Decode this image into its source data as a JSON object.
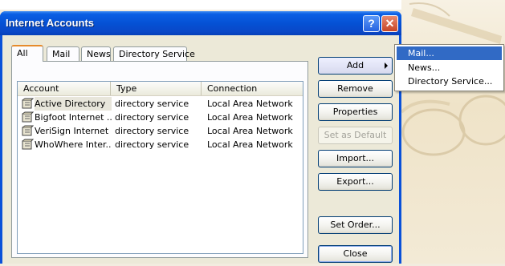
{
  "window": {
    "title": "Internet Accounts",
    "help_button": "?",
    "close_button": "✕"
  },
  "tabs": [
    {
      "label": "All",
      "active": true
    },
    {
      "label": "Mail",
      "active": false
    },
    {
      "label": "News",
      "active": false
    },
    {
      "label": "Directory Service",
      "active": false
    }
  ],
  "table": {
    "columns": [
      "Account",
      "Type",
      "Connection"
    ],
    "rows": [
      {
        "account": "Active Directory",
        "type": "directory service",
        "connection": "Local Area Network"
      },
      {
        "account": "Bigfoot Internet ...",
        "type": "directory service",
        "connection": "Local Area Network"
      },
      {
        "account": "VeriSign Internet ...",
        "type": "directory service",
        "connection": "Local Area Network"
      },
      {
        "account": "WhoWhere Inter...",
        "type": "directory service",
        "connection": "Local Area Network"
      }
    ]
  },
  "buttons": {
    "add": "Add",
    "remove": "Remove",
    "properties": "Properties",
    "set_default": "Set as Default",
    "import": "Import...",
    "export": "Export...",
    "set_order": "Set Order...",
    "close": "Close"
  },
  "add_menu": {
    "items": [
      "Mail...",
      "News...",
      "Directory Service..."
    ],
    "highlighted": "Mail..."
  },
  "colors": {
    "title_bar": "#0550d3",
    "menu_highlight": "#316ac5",
    "dialog_face": "#ece9d8"
  }
}
